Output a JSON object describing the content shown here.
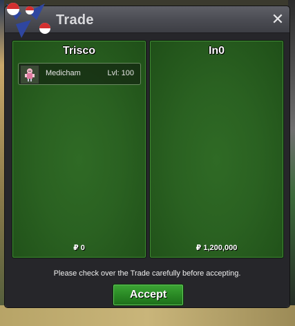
{
  "window": {
    "title": "Trade",
    "close_glyph": "✕"
  },
  "left_panel": {
    "player_name": "Trisco",
    "items": [
      {
        "icon": "medicham-sprite-icon",
        "name": "Medicham",
        "level": "Lvl: 100"
      }
    ],
    "money": "₽ 0"
  },
  "right_panel": {
    "player_name": "In0",
    "items": [],
    "money": "₽ 1,200,000"
  },
  "footer": {
    "notice": "Please check over the Trade carefully before accepting.",
    "accept_label": "Accept"
  },
  "colors": {
    "panel_green": "#2a6121",
    "button_green": "#2a8a25",
    "titlebar_gray": "#4a4b52"
  }
}
